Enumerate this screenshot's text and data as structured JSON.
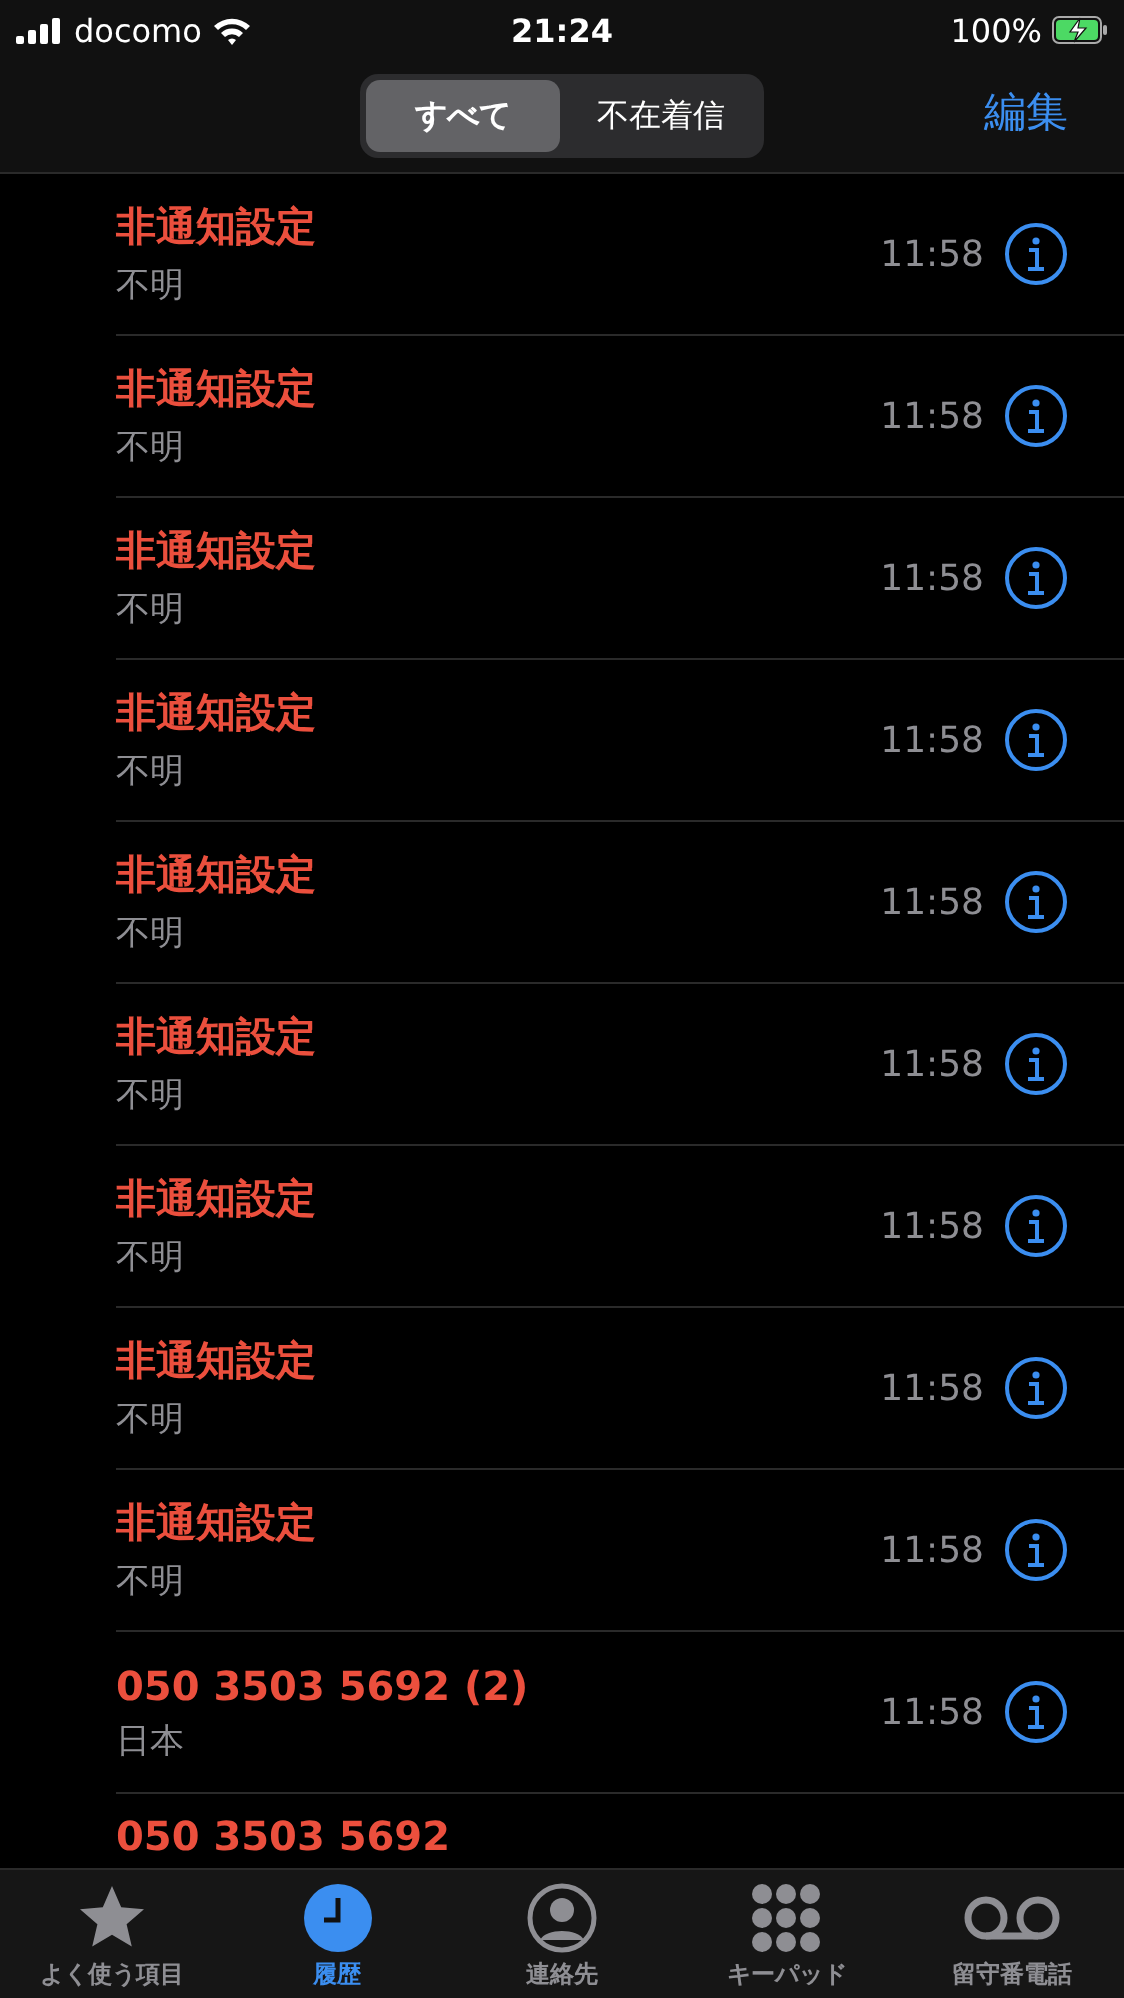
{
  "status_bar": {
    "carrier": "docomo",
    "time": "21:24",
    "battery": "100%"
  },
  "segments": [
    {
      "label": "すべて",
      "selected": true
    },
    {
      "label": "不在着信",
      "selected": false
    }
  ],
  "edit_button": "編集",
  "calls": [
    {
      "name": "非通知設定",
      "detail": "不明",
      "time": "11:58",
      "missed": true
    },
    {
      "name": "非通知設定",
      "detail": "不明",
      "time": "11:58",
      "missed": true
    },
    {
      "name": "非通知設定",
      "detail": "不明",
      "time": "11:58",
      "missed": true
    },
    {
      "name": "非通知設定",
      "detail": "不明",
      "time": "11:58",
      "missed": true
    },
    {
      "name": "非通知設定",
      "detail": "不明",
      "time": "11:58",
      "missed": true
    },
    {
      "name": "非通知設定",
      "detail": "不明",
      "time": "11:58",
      "missed": true
    },
    {
      "name": "非通知設定",
      "detail": "不明",
      "time": "11:58",
      "missed": true
    },
    {
      "name": "非通知設定",
      "detail": "不明",
      "time": "11:58",
      "missed": true
    },
    {
      "name": "非通知設定",
      "detail": "不明",
      "time": "11:58",
      "missed": true
    },
    {
      "name": "050 3503 5692 (2)",
      "detail": "日本",
      "time": "11:58",
      "missed": true
    },
    {
      "name": "050 3503 5692",
      "missed": true
    }
  ],
  "tab_bar": [
    {
      "kind": "favorites",
      "label": "よく使う項目",
      "selected": false
    },
    {
      "kind": "recents",
      "label": "履歴",
      "selected": true
    },
    {
      "kind": "contacts",
      "label": "連絡先",
      "selected": false
    },
    {
      "kind": "keypad",
      "label": "キーパッド",
      "selected": false
    },
    {
      "kind": "voicemail",
      "label": "留守番電話",
      "selected": false
    }
  ]
}
